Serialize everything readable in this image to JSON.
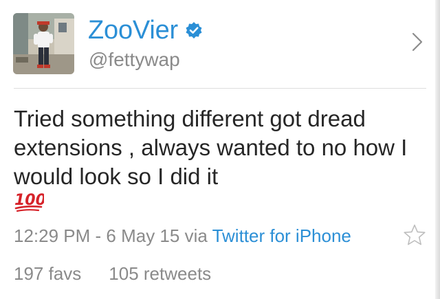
{
  "user": {
    "display_name": "ZooVier",
    "handle": "@fettywap",
    "verified": true,
    "avatar_icon": "user-photo"
  },
  "tweet": {
    "text": "Tried something different got dread extensions , always wanted to no how I would look so I did it",
    "emoji": "100",
    "time": "12:29 PM",
    "date_separator": " - ",
    "date": "6 May 15",
    "via_label": " via ",
    "source": "Twitter for iPhone"
  },
  "stats": {
    "favs": "197 favs",
    "retweets": "105 retweets"
  },
  "colors": {
    "link_blue": "#2b8fd6",
    "meta_gray": "#8a8a8a",
    "emoji_red": "#d6232a"
  }
}
